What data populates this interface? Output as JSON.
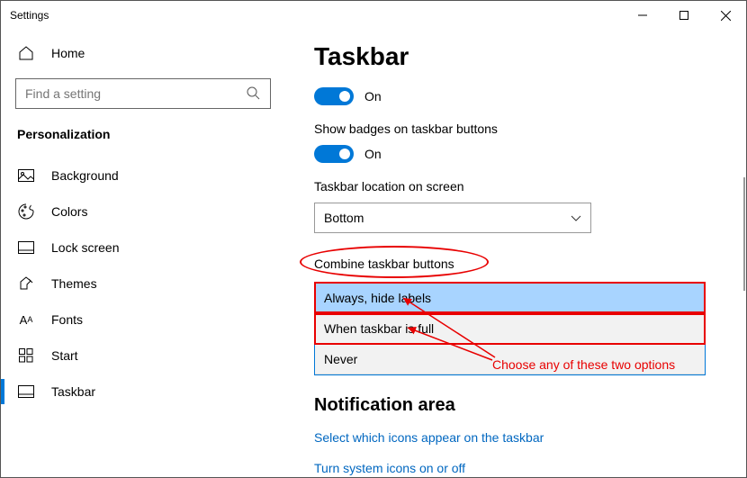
{
  "window": {
    "title": "Settings"
  },
  "sidebar": {
    "home": "Home",
    "search_placeholder": "Find a setting",
    "section": "Personalization",
    "items": [
      {
        "label": "Background"
      },
      {
        "label": "Colors"
      },
      {
        "label": "Lock screen"
      },
      {
        "label": "Themes"
      },
      {
        "label": "Fonts"
      },
      {
        "label": "Start"
      },
      {
        "label": "Taskbar"
      }
    ]
  },
  "main": {
    "title": "Taskbar",
    "toggle1_state": "On",
    "badges_label": "Show badges on taskbar buttons",
    "toggle2_state": "On",
    "location_label": "Taskbar location on screen",
    "location_value": "Bottom",
    "combine_label": "Combine taskbar buttons",
    "combine_options": [
      "Always, hide labels",
      "When taskbar is full",
      "Never"
    ],
    "notification_heading": "Notification area",
    "link1": "Select which icons appear on the taskbar",
    "link2": "Turn system icons on or off"
  },
  "annotation": {
    "text": "Choose any of these two options"
  }
}
